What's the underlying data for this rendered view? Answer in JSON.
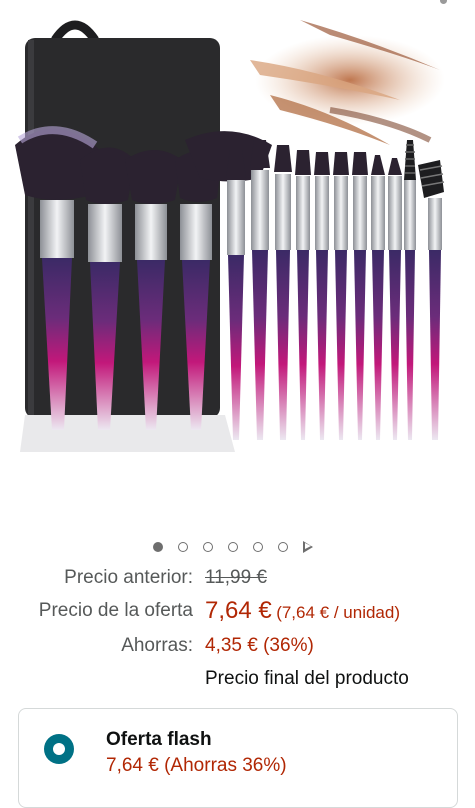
{
  "product_image": {
    "alt": "Juego de brochas de maquillaje con mangos de cristal morado y estuche negro",
    "brush_colors": {
      "bristle": "#2b2230",
      "ferrule": "#c9ccd1",
      "handle_top": "#3b2a66",
      "handle_mid": "#c2187a",
      "handle_bottom": "#e8e4ee",
      "case": "#2a2a2c",
      "powder": "#c27a4f"
    }
  },
  "carousel": {
    "total_dots": 6,
    "active_index": 0,
    "next_icon": "play-icon"
  },
  "prices": {
    "previous_label": "Precio anterior:",
    "previous_value": "11,99 €",
    "deal_label": "Precio de la oferta",
    "deal_value": "7,64 €",
    "deal_unit": "(7,64 € / unidad)",
    "savings_label": "Ahorras:",
    "savings_value": "4,35 € (36%)",
    "final_note": "Precio final del producto"
  },
  "flash_offer": {
    "title": "Oferta flash",
    "price_text": "7,64 € (Ahorras 36%)",
    "selected": true,
    "accent_color": "#007185"
  }
}
